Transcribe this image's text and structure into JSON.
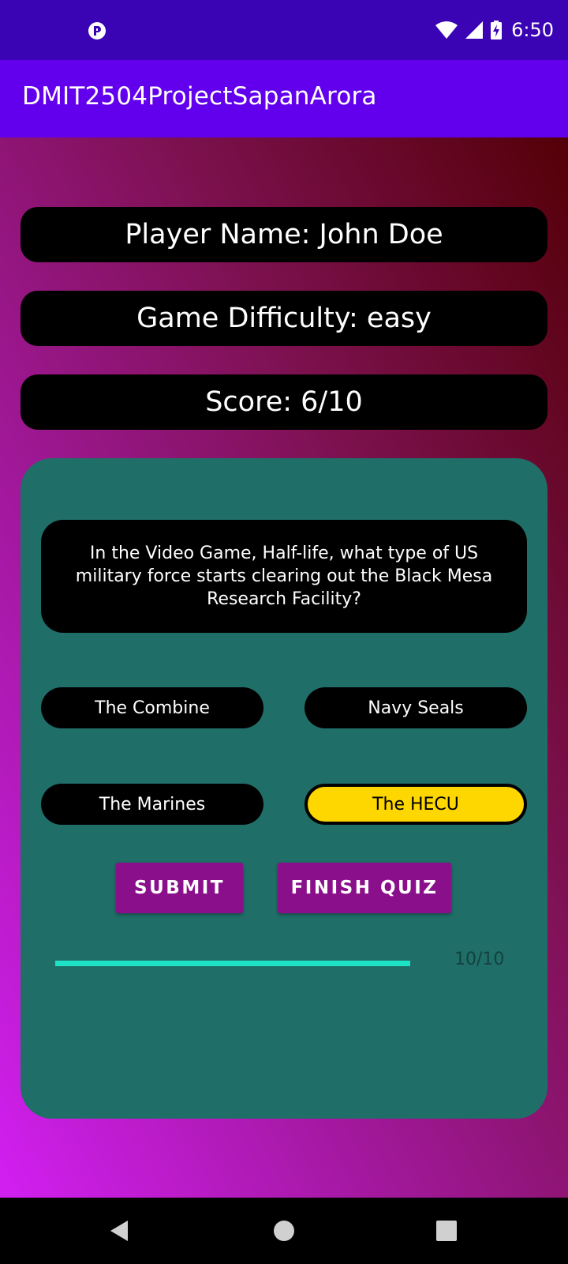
{
  "status_bar": {
    "time": "6:50",
    "icons": [
      "app-notification-icon",
      "wifi-icon",
      "signal-icon",
      "battery-charging-icon"
    ]
  },
  "app_bar": {
    "title": "DMIT2504ProjectSapanArora"
  },
  "player": {
    "name_label": "Player Name: John Doe",
    "difficulty_label": "Game Difficulty: easy",
    "score_label": "Score: 6/10"
  },
  "quiz": {
    "question": "In the Video Game, Half-life, what type of US military force starts clearing out the Black Mesa Research Facility?",
    "answers": [
      {
        "label": "The Combine",
        "selected": false
      },
      {
        "label": "Navy Seals",
        "selected": false
      },
      {
        "label": "The Marines",
        "selected": false
      },
      {
        "label": "The HECU",
        "selected": true
      }
    ],
    "submit_label": "SUBMIT",
    "finish_label": "FINISH QUIZ",
    "progress": {
      "value": 10,
      "max": 10,
      "label": "10/10"
    }
  },
  "colors": {
    "status_bar": "#3a04b4",
    "app_bar": "#6200ee",
    "card": "#206e68",
    "selected_answer": "#ffd700",
    "button": "#8a0f8a",
    "progress": "#1de2c6"
  },
  "nav_bar": {
    "icons": [
      "back-icon",
      "home-icon",
      "recents-icon"
    ]
  }
}
